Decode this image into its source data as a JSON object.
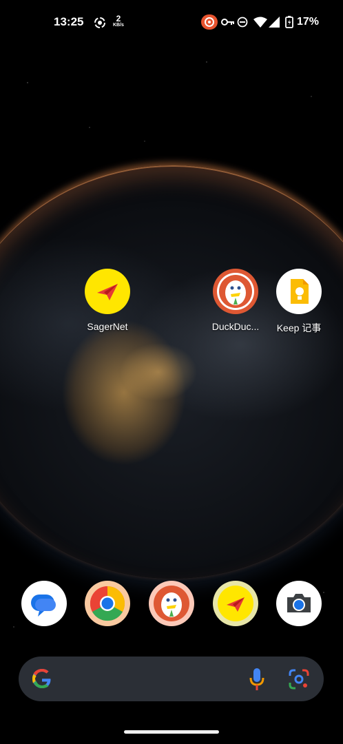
{
  "status_bar": {
    "time": "13:25",
    "net_speed_value": "2",
    "net_speed_unit": "KB/s",
    "battery_percent": "17%",
    "icons": [
      "focus-icon",
      "vpn-badge-icon",
      "key-icon",
      "do-not-disturb-icon",
      "wifi-icon",
      "signal-icon",
      "battery-icon"
    ]
  },
  "home": {
    "apps": [
      {
        "label": "SagerNet",
        "icon": "sagernet-icon",
        "color": "#ffe600"
      },
      {
        "label": "DuckDuc...",
        "icon": "duckduckgo-icon",
        "color": "#de5833"
      },
      {
        "label": "Keep 记事",
        "icon": "keep-icon",
        "color": "#fbbc04"
      }
    ]
  },
  "dock": {
    "apps": [
      {
        "icon": "messages-icon",
        "color": "#1a73e8"
      },
      {
        "icon": "chrome-icon",
        "color": "#ea4335"
      },
      {
        "icon": "duckduckgo-icon",
        "color": "#de5833"
      },
      {
        "icon": "sagernet-icon",
        "color": "#ffe600"
      },
      {
        "icon": "camera-icon",
        "color": "#1a73e8"
      }
    ]
  },
  "search": {
    "icons": [
      "google-g-icon",
      "microphone-icon",
      "google-lens-icon"
    ]
  }
}
